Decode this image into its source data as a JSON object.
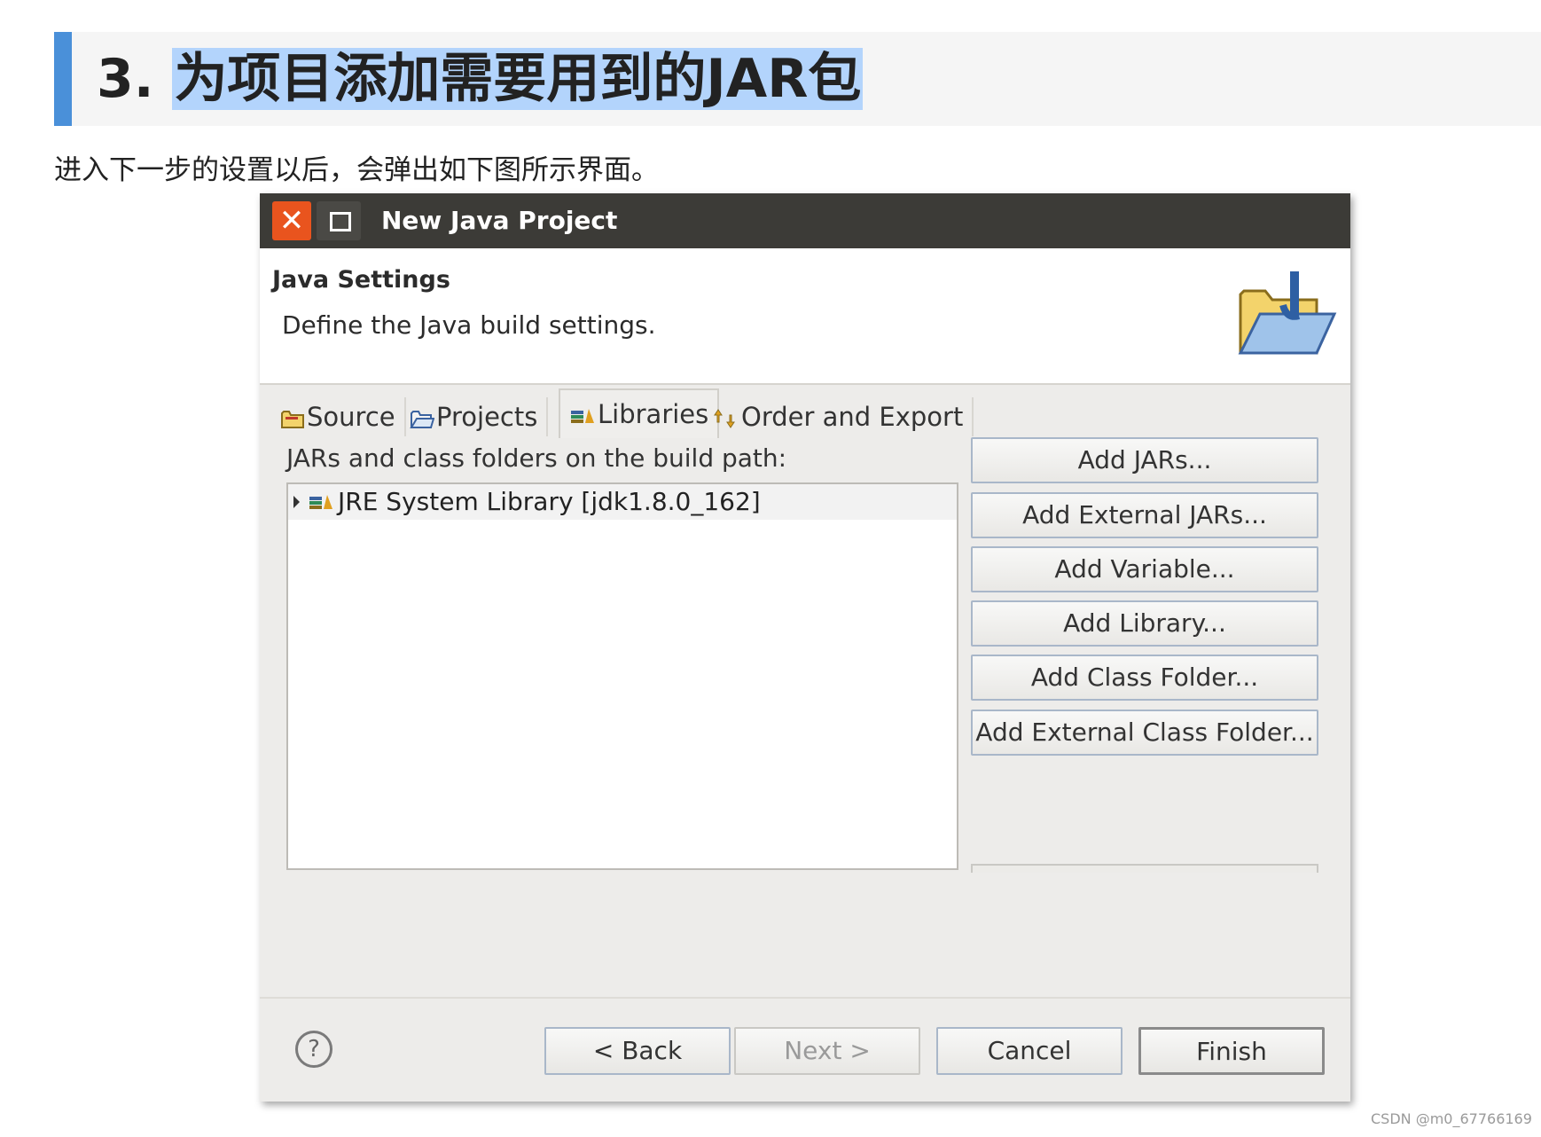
{
  "article": {
    "heading_number": "3.",
    "heading_text": "为项目添加需要用到的JAR包",
    "intro": "进入下一步的设置以后，会弹出如下图所示界面。"
  },
  "dialog": {
    "title": "New Java Project",
    "close_glyph": "✕",
    "banner": {
      "title": "Java Settings",
      "description": "Define the Java build settings."
    },
    "tabs": [
      {
        "label": "Source",
        "icon": "source-folder-icon"
      },
      {
        "label": "Projects",
        "icon": "projects-folder-icon"
      },
      {
        "label": "Libraries",
        "icon": "libraries-icon",
        "active": true
      },
      {
        "label": "Order and Export",
        "icon": "order-export-icon"
      }
    ],
    "buildpath_label": "JARs and class folders on the build path:",
    "libraries": [
      {
        "label": "JRE System Library [jdk1.8.0_162]",
        "icon": "library-icon"
      }
    ],
    "side_buttons": [
      "Add JARs...",
      "Add External JARs...",
      "Add Variable...",
      "Add Library...",
      "Add Class Folder...",
      "Add External Class Folder..."
    ],
    "help_glyph": "?",
    "buttons": {
      "back": "< Back",
      "next": "Next >",
      "cancel": "Cancel",
      "finish": "Finish"
    }
  },
  "watermark": "CSDN @m0_67766169",
  "colors": {
    "heading_accent": "#4a90d9",
    "selection": "#b3d4fc",
    "titlebar": "#3c3b37",
    "close_button": "#e9541e"
  }
}
